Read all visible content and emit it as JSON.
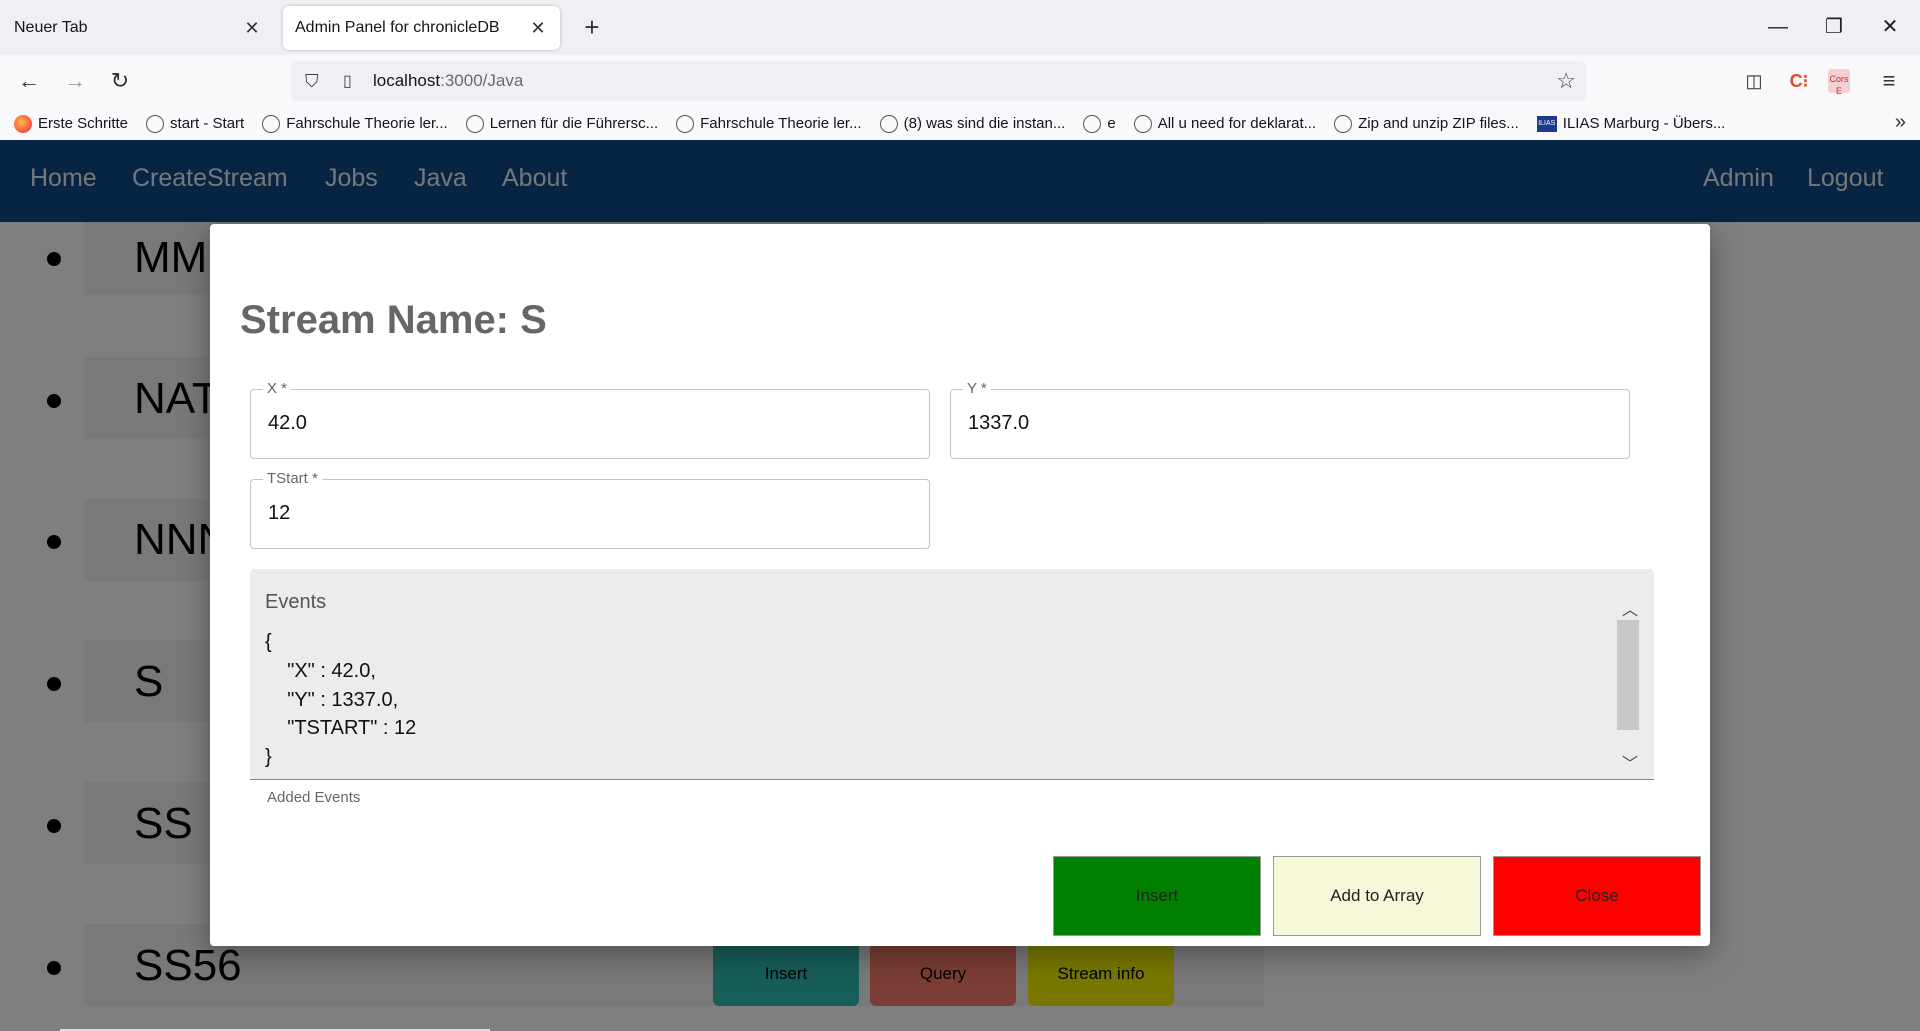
{
  "browser": {
    "tabs": [
      {
        "title": "Neuer Tab",
        "active": false
      },
      {
        "title": "Admin Panel for chronicleDB",
        "active": true
      }
    ],
    "url_host": "localhost",
    "url_path": ":3000/Java",
    "bookmarks": [
      "Erste Schritte",
      "start - Start",
      "Fahrschule Theorie ler...",
      "Lernen für die Führersc...",
      "Fahrschule Theorie ler...",
      "(8) was sind die instan...",
      "e",
      "All u need for deklarat...",
      "Zip and unzip ZIP files...",
      "ILIAS Marburg - Übers..."
    ]
  },
  "app_nav": {
    "left": [
      "Home",
      "CreateStream",
      "Jobs",
      "Java",
      "About"
    ],
    "right": [
      "Admin",
      "Logout"
    ]
  },
  "streams": [
    "MM",
    "NAT",
    "NNN",
    "S",
    "SS",
    "SS56"
  ],
  "page_buttons": {
    "insert": "Insert",
    "query": "Query",
    "stream_info": "Stream info"
  },
  "modal": {
    "title": "Stream Name: S",
    "fields": {
      "x": {
        "label": "X *",
        "value": "42.0"
      },
      "y": {
        "label": "Y *",
        "value": "1337.0"
      },
      "tstart": {
        "label": "TStart *",
        "value": "12"
      }
    },
    "events_label": "Events",
    "events_lines": [
      "{",
      "    \"X\" : 42.0,",
      "    \"Y\" : 1337.0,",
      "    \"TSTART\" : 12",
      "}"
    ],
    "events_helper": "Added Events",
    "buttons": {
      "insert": "Insert",
      "add_to_array": "Add to Array",
      "close": "Close"
    },
    "colors": {
      "insert": "#008000",
      "add_to_array": "#f7f7d9",
      "close": "#ff0000"
    }
  }
}
